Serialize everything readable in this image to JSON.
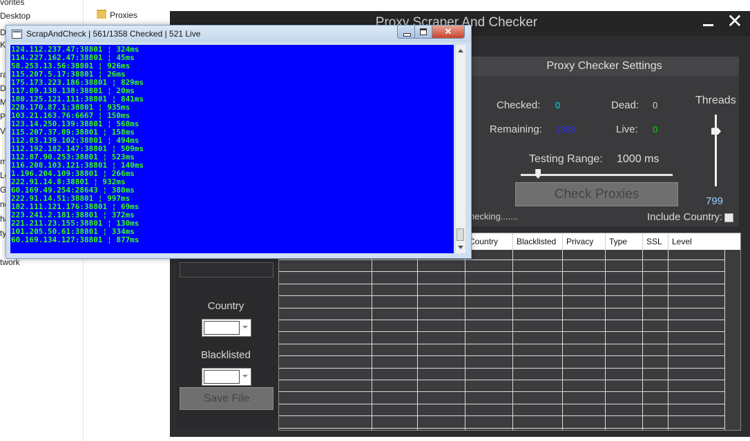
{
  "explorer": {
    "nav_items": [
      "vorites",
      "Desktop",
      "Do",
      "Ke",
      "ra",
      "Do",
      "Mi",
      "Pi",
      "Vi",
      "m",
      "Lo",
      "Ga",
      "ne",
      "ha",
      "ty",
      "twork"
    ],
    "folder_label": "Proxies"
  },
  "app": {
    "title": "Proxy Scraper And Checker",
    "close_glyph": "✕",
    "settings": {
      "header": "Proxy Checker Settings",
      "checked_label": "Checked:",
      "checked_value": "0",
      "dead_label": "Dead:",
      "dead_value": "0",
      "remaining_label": "Remaining:",
      "remaining_value": "1358",
      "live_label": "Live:",
      "live_value": "0",
      "threads_label": "Threads",
      "threads_value": "799",
      "testing_range_label": "Testing Range:",
      "testing_range_value": "1000 ms",
      "testing_range_fraction": 0.1,
      "threads_fraction": 0.8,
      "check_button": "Check Proxies",
      "status_text": "hecking.......",
      "include_country_label": "Include Country:"
    },
    "filters": {
      "country_label": "Country",
      "blacklisted_label": "Blacklisted",
      "save_button": "Save File"
    },
    "grid": {
      "columns": [
        "Country",
        "Blacklisted",
        "Privacy",
        "Type",
        "SSL",
        "Level"
      ]
    },
    "colors": {
      "checked": "#00e5e5",
      "dead": "#d0d0d0",
      "remaining": "#2a2aff",
      "live": "#00e000",
      "threads_value": "#9ad0ff",
      "testing_range_value": "#e0e0e0"
    }
  },
  "console": {
    "title": "ScrapAndCheck | 561/1358 Checked | 521 Live",
    "close_glyph": "✕",
    "lines": [
      "124.112.237.47:38801 ¦ 324ms",
      "114.227.162.47:38801 ¦ 45ms",
      "58.253.13.56:38801 ¦ 926ms",
      "115.207.5.17:38801 ¦ 26ms",
      "175.173.223.186:38801 ¦ 829ms",
      "117.89.138.138:38801 ¦ 20ms",
      "180.125.121.111:38801 ¦ 841ms",
      "220.170.87.1:38801 ¦ 935ms",
      "103.21.163.76:6667 ¦ 150ms",
      "123.14.250.139:38801 ¦ 568ms",
      "115.207.37.89:38801 ¦ 158ms",
      "112.83.139.102:38801 ¦ 494ms",
      "112.192.182.147:38801 ¦ 509ms",
      "112.87.90.253:38801 ¦ 523ms",
      "116.208.103.121:38801 ¦ 140ms",
      "1.196.204.109:38801 ¦ 266ms",
      "222.91.14.8:38801 ¦ 932ms",
      "60.169.49.254:28643 ¦ 380ms",
      "222.91.14.51:38801 ¦ 997ms",
      "182.111.121.176:38801 ¦ 69ms",
      "223.241.2.181:38801 ¦ 372ms",
      "221.211.23.155:38801 ¦ 130ms",
      "101.205.50.61:38801 ¦ 334ms",
      "60.169.134.127:38801 ¦ 877ms"
    ]
  }
}
